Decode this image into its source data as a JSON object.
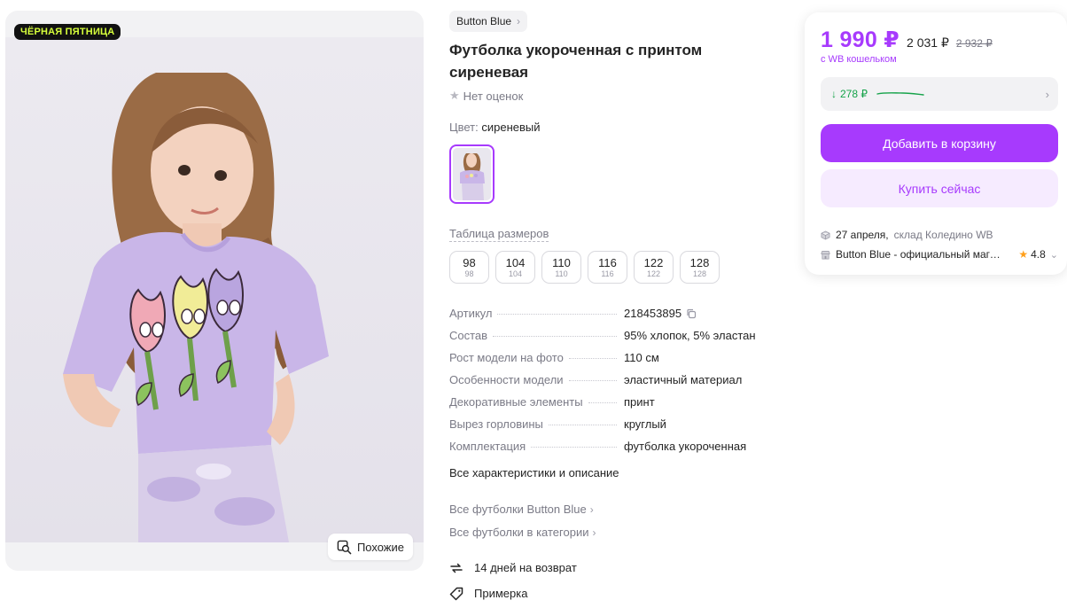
{
  "photo": {
    "badge": "ЧЁРНАЯ ПЯТНИЦА",
    "similar_label": "Похожие"
  },
  "product": {
    "brand": "Button Blue",
    "title": "Футболка укороченная с принтом сиреневая",
    "rating_text": "Нет оценок",
    "color_label": "Цвет:",
    "color_value": "сиреневый",
    "size_table_link": "Таблица размеров",
    "sizes": [
      {
        "value": "98",
        "sub": "98"
      },
      {
        "value": "104",
        "sub": "104"
      },
      {
        "value": "110",
        "sub": "110"
      },
      {
        "value": "116",
        "sub": "116"
      },
      {
        "value": "122",
        "sub": "122"
      },
      {
        "value": "128",
        "sub": "128"
      }
    ],
    "specs": [
      {
        "key": "Артикул",
        "value": "218453895"
      },
      {
        "key": "Состав",
        "value": "95% хлопок, 5% эластан"
      },
      {
        "key": "Рост модели на фото",
        "value": "110 см"
      },
      {
        "key": "Особенности модели",
        "value": "эластичный материал"
      },
      {
        "key": "Декоративные элементы",
        "value": "принт"
      },
      {
        "key": "Вырез горловины",
        "value": "круглый"
      },
      {
        "key": "Комплектация",
        "value": "футболка укороченная"
      }
    ],
    "all_specs_link": "Все характеристики и описание",
    "links": [
      "Все футболки Button Blue",
      "Все футболки в категории"
    ],
    "perks": [
      "14 дней на возврат",
      "Примерка"
    ]
  },
  "price_card": {
    "price": "1 990 ₽",
    "price_old1": "2 031 ₽",
    "price_old2": "2 932 ₽",
    "wallet_note": "с WB кошельком",
    "history_amount": "278 ₽",
    "add_to_cart": "Добавить в корзину",
    "buy_now": "Купить сейчас",
    "delivery_date": "27 апреля,",
    "warehouse": "склад Коледино WB",
    "seller": "Button Blue - официальный магазин",
    "seller_rating": "4.8",
    "colors": {
      "accent": "#a73afd",
      "accent_light": "#f6ebff",
      "green": "#16a34a"
    }
  }
}
